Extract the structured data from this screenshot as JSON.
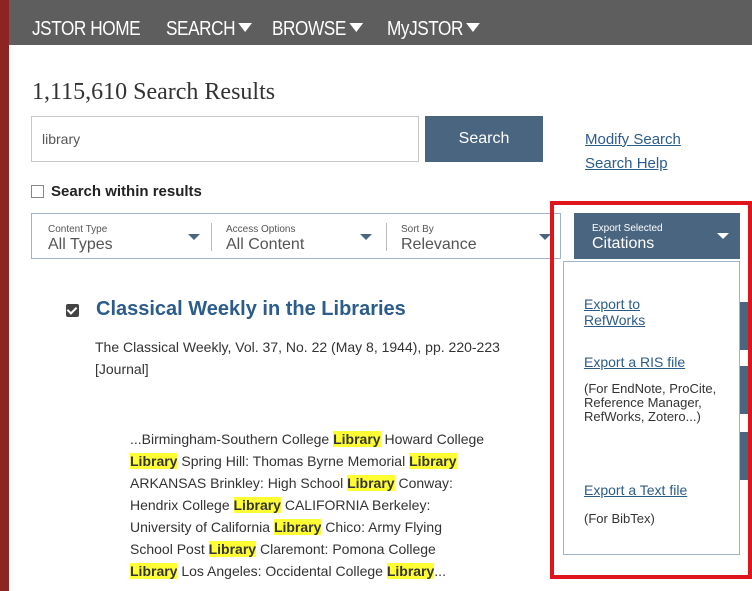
{
  "nav": {
    "home": "JSTOR HOME",
    "search": "SEARCH",
    "browse": "BROWSE",
    "myjstor": "MyJSTOR"
  },
  "results": {
    "count_title": "1,115,610 Search Results"
  },
  "search": {
    "query": "library",
    "button_label": "Search",
    "modify_link": "Modify Search",
    "help_link": "Search Help",
    "within_label": "Search within results"
  },
  "filters": {
    "content_type": {
      "label": "Content Type",
      "value": "All Types"
    },
    "access": {
      "label": "Access Options",
      "value": "All Content"
    },
    "sort": {
      "label": "Sort By",
      "value": "Relevance"
    }
  },
  "export": {
    "label_small": "Export Selected",
    "label_main": "Citations",
    "refworks": "Export to RefWorks",
    "ris": "Export a RIS file",
    "ris_note": "(For EndNote, ProCite, Reference Manager, RefWorks, Zotero...)",
    "text": "Export a Text file",
    "text_note": "(For BibTex)"
  },
  "result": {
    "title": "Classical Weekly in the Libraries",
    "meta": "The Classical Weekly, Vol. 37, No. 22 (May 8, 1944), pp. 220-223",
    "type": "[Journal]",
    "snippet": [
      [
        "...Birmingham-Southern College ",
        "Library",
        " Howard College"
      ],
      [
        "",
        "Library",
        " Spring Hill: Thomas Byrne Memorial ",
        "Library"
      ],
      [
        "ARKANSAS Brinkley: High School ",
        "Library",
        " Conway:"
      ],
      [
        "Hendrix College ",
        "Library",
        " CALIFORNIA Berkeley:"
      ],
      [
        "University of California ",
        "Library",
        " Chico: Army Flying"
      ],
      [
        "School Post ",
        "Library",
        " Claremont: Pomona College"
      ],
      [
        "",
        "Library",
        " Los Angeles: Occidental College ",
        "Library",
        "..."
      ]
    ]
  }
}
